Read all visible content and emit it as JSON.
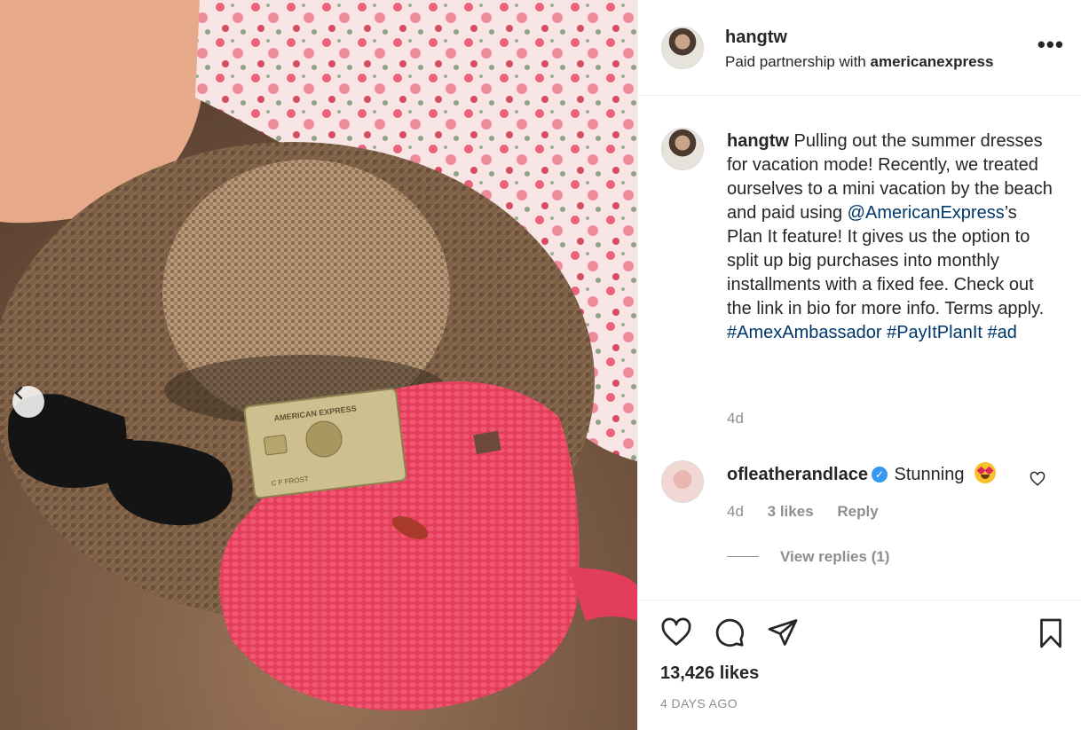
{
  "post": {
    "image_alt": "Straw hat, sunglasses, gold card and pink crochet bag on sand",
    "card_brand": "AMERICAN EXPRESS",
    "card_holder": "C F FROST"
  },
  "header": {
    "username": "hangtw",
    "partnership_prefix": "Paid partnership with",
    "partner": "americanexpress",
    "more_label": "•••"
  },
  "caption": {
    "username": "hangtw",
    "text_1": " Pulling out the summer dresses for vacation mode! Recently, we treated ourselves to a mini vacation by the beach and paid using ",
    "mention": "@AmericanExpress",
    "text_2": "’s Plan It feature! It gives us the option to split up big purchases into monthly installments with a fixed fee. Check out the link in bio for more info. Terms apply. ",
    "tag_1": "#AmexAmbassador",
    "tag_2": "#PayItPlanIt",
    "tag_3": "#ad",
    "timestamp": "4d"
  },
  "comment": {
    "username": "ofleatherandlace",
    "verified_glyph": "✓",
    "text": "Stunning",
    "time": "4d",
    "likes": "3 likes",
    "reply": "Reply",
    "view_replies": "View replies (1)"
  },
  "footer": {
    "likes": "13,426 likes",
    "posted": "4 DAYS AGO"
  },
  "icons": {
    "prev": "chevron-left-icon",
    "like": "heart-icon",
    "comment": "comment-icon",
    "share": "paper-plane-icon",
    "save": "bookmark-icon"
  }
}
